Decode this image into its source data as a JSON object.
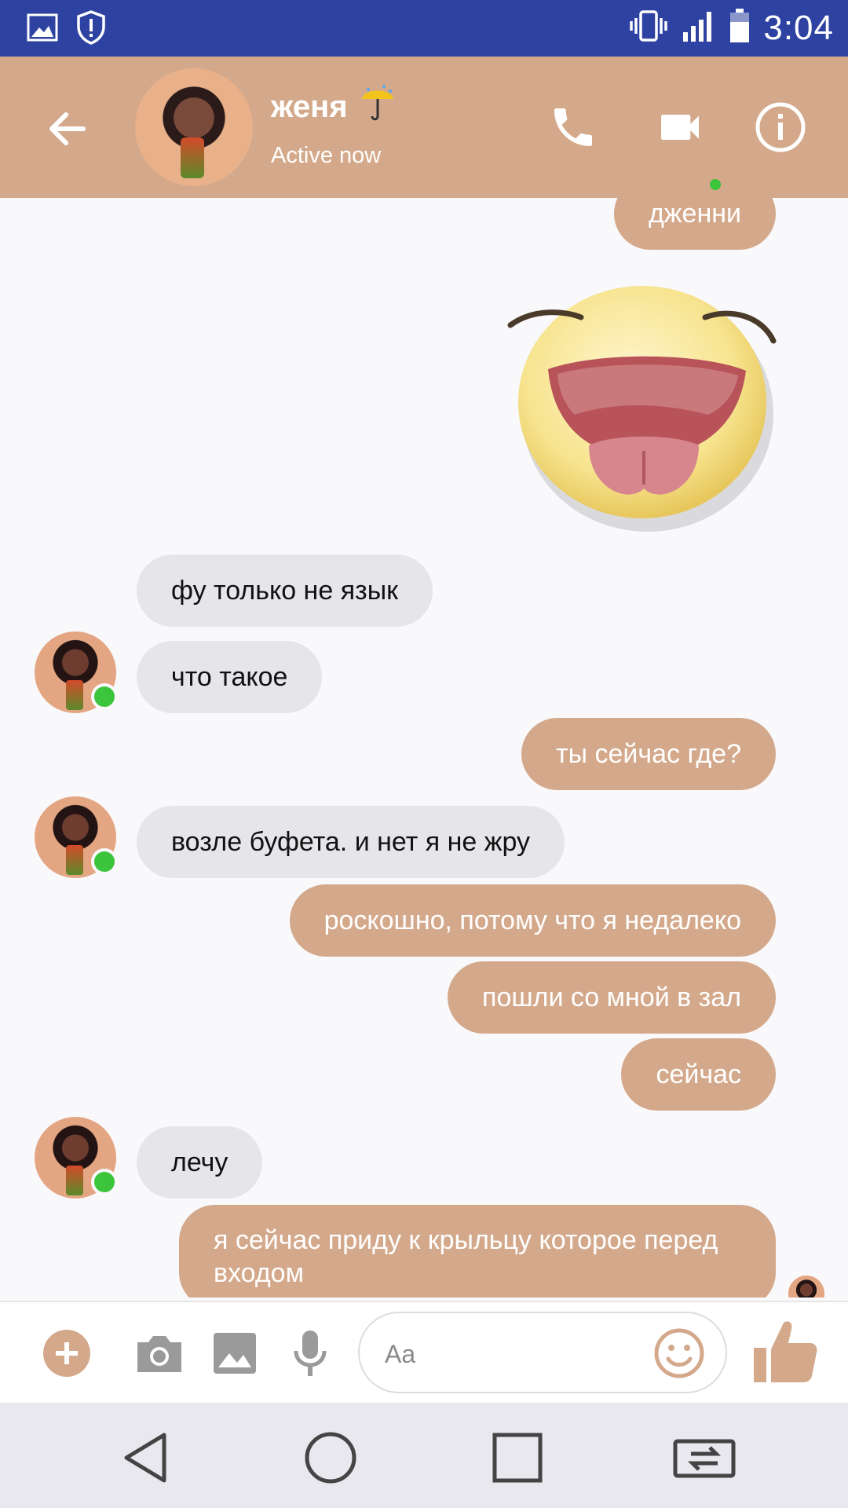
{
  "status_bar": {
    "time": "3:04",
    "icons": [
      "gallery-icon",
      "shield-alert-icon",
      "vibrate-icon",
      "signal-icon",
      "battery-icon"
    ],
    "color": "#2d42a1"
  },
  "header": {
    "contact_name": "женя",
    "name_emoji": "☂️",
    "status": "Active now",
    "accent_color": "#d4a98b",
    "actions": [
      "phone-icon",
      "video-camera-icon",
      "info-icon"
    ]
  },
  "messages": [
    {
      "direction": "out",
      "text": "дженни"
    },
    {
      "direction": "out",
      "type": "sticker",
      "sticker": "tongue-out-smiley"
    },
    {
      "direction": "in",
      "text": "фу только не язык"
    },
    {
      "direction": "in",
      "text": "что такое"
    },
    {
      "direction": "out",
      "text": "ты сейчас где?"
    },
    {
      "direction": "in",
      "text": "возле буфета. и нет я не жру"
    },
    {
      "direction": "out",
      "text": "роскошно, потому что я недалеко"
    },
    {
      "direction": "out",
      "text": "пошли со мной в зал"
    },
    {
      "direction": "out",
      "text": "сейчас"
    },
    {
      "direction": "in",
      "text": "лечу"
    },
    {
      "direction": "out",
      "text": "я сейчас приду к крыльцу которое перед входом"
    }
  ],
  "composer": {
    "placeholder": "Aa",
    "icons": [
      "plus-icon",
      "camera-icon",
      "gallery-icon",
      "microphone-icon",
      "emoji-icon",
      "thumbs-up-icon"
    ]
  },
  "nav_bar": {
    "icons": [
      "back-triangle-icon",
      "home-circle-icon",
      "recents-square-icon",
      "switch-app-icon"
    ]
  }
}
